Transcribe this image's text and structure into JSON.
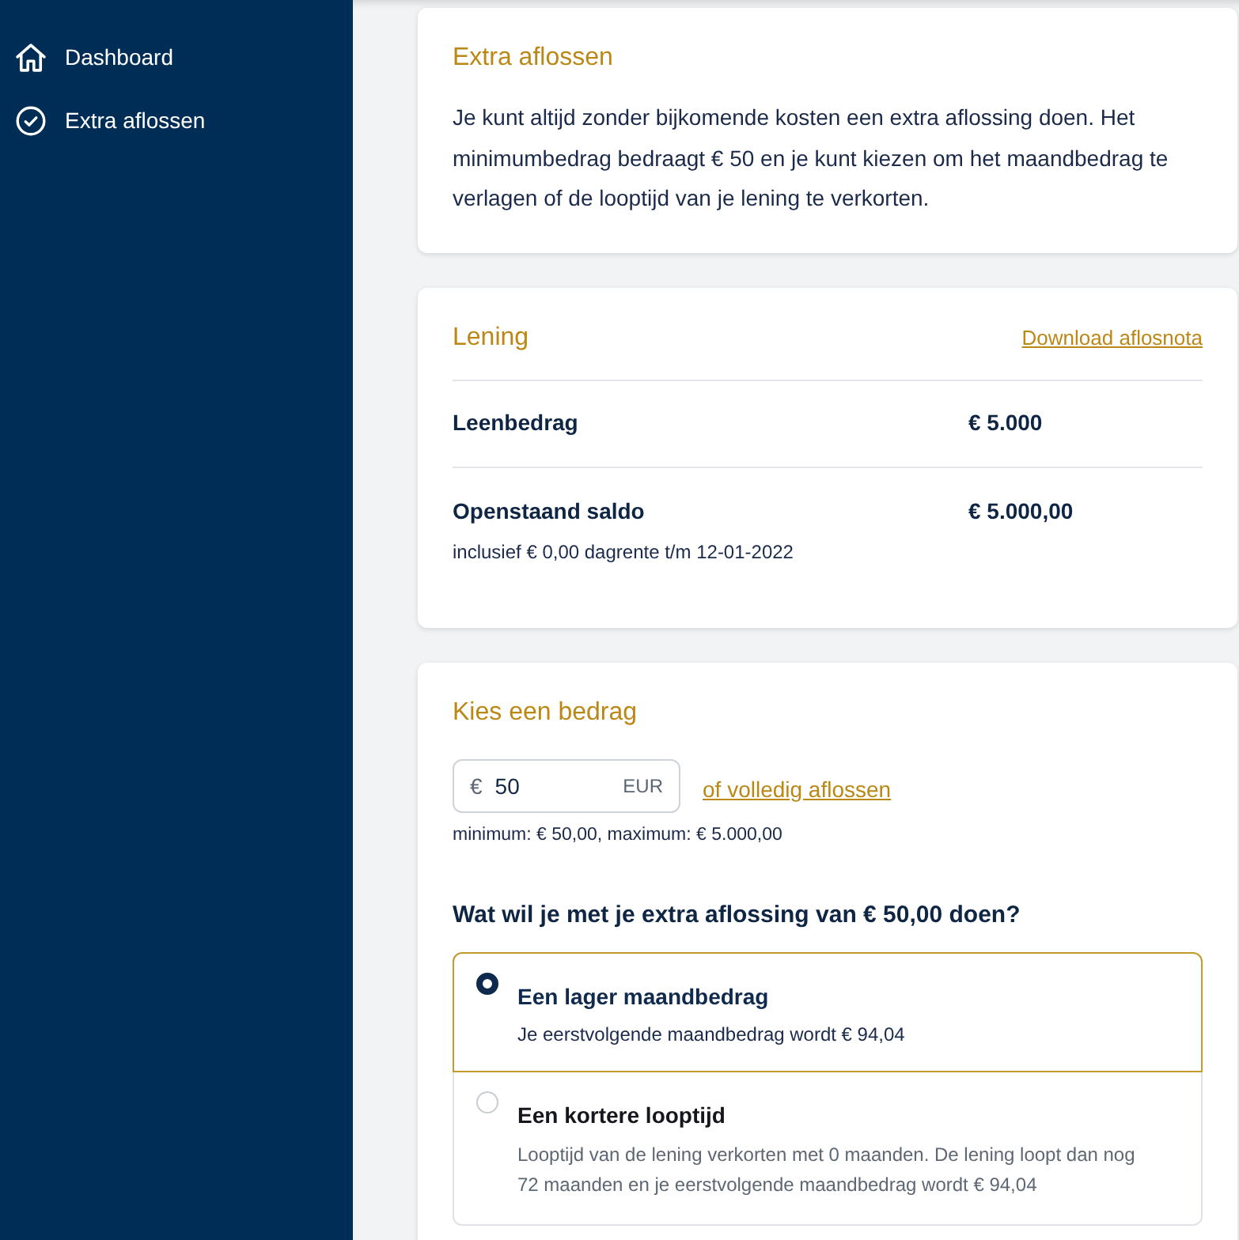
{
  "sidebar": {
    "items": [
      {
        "label": "Dashboard"
      },
      {
        "label": "Extra aflossen"
      }
    ]
  },
  "intro": {
    "title": "Extra aflossen",
    "text": "Je kunt altijd zonder bijkomende kosten een extra aflossing doen. Het minimumbedrag bedraagt € 50 en je kunt kiezen om het maandbedrag te verlagen of de looptijd van je lening te verkorten."
  },
  "loan": {
    "title": "Lening",
    "link": "Download aflosnota",
    "rows": [
      {
        "label": "Leenbedrag",
        "value": "€ 5.000"
      },
      {
        "label": "Openstaand saldo",
        "value": "€ 5.000,00",
        "note": "inclusief € 0,00 dagrente t/m 12-01-2022"
      }
    ]
  },
  "amount": {
    "title": "Kies een bedrag",
    "field": {
      "prefix": "€",
      "value": "50",
      "suffix": "EUR"
    },
    "link": "of volledig aflossen",
    "hint": "minimum: € 50,00, maximum: € 5.000,00",
    "question": "Wat wil je met je extra aflossing van € 50,00 doen?",
    "options": [
      {
        "title": "Een lager maandbedrag",
        "description": "Je eerstvolgende maandbedrag wordt € 94,04",
        "selected": true
      },
      {
        "title": "Een kortere looptijd",
        "description": "Looptijd van de lening verkorten met 0 maanden. De lening loopt dan nog 72 maanden en je eerstvolgende maandbedrag wordt € 94,04",
        "selected": false
      }
    ]
  }
}
